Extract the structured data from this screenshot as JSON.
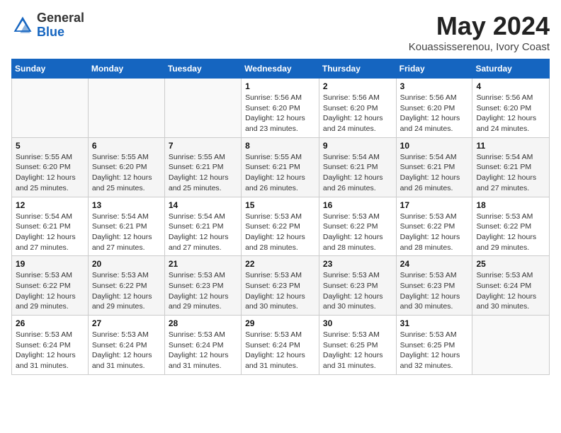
{
  "logo": {
    "general": "General",
    "blue": "Blue"
  },
  "title": "May 2024",
  "subtitle": "Kouassisserenou, Ivory Coast",
  "days_header": [
    "Sunday",
    "Monday",
    "Tuesday",
    "Wednesday",
    "Thursday",
    "Friday",
    "Saturday"
  ],
  "weeks": [
    [
      {
        "day": "",
        "info": ""
      },
      {
        "day": "",
        "info": ""
      },
      {
        "day": "",
        "info": ""
      },
      {
        "day": "1",
        "info": "Sunrise: 5:56 AM\nSunset: 6:20 PM\nDaylight: 12 hours\nand 23 minutes."
      },
      {
        "day": "2",
        "info": "Sunrise: 5:56 AM\nSunset: 6:20 PM\nDaylight: 12 hours\nand 24 minutes."
      },
      {
        "day": "3",
        "info": "Sunrise: 5:56 AM\nSunset: 6:20 PM\nDaylight: 12 hours\nand 24 minutes."
      },
      {
        "day": "4",
        "info": "Sunrise: 5:56 AM\nSunset: 6:20 PM\nDaylight: 12 hours\nand 24 minutes."
      }
    ],
    [
      {
        "day": "5",
        "info": "Sunrise: 5:55 AM\nSunset: 6:20 PM\nDaylight: 12 hours\nand 25 minutes."
      },
      {
        "day": "6",
        "info": "Sunrise: 5:55 AM\nSunset: 6:20 PM\nDaylight: 12 hours\nand 25 minutes."
      },
      {
        "day": "7",
        "info": "Sunrise: 5:55 AM\nSunset: 6:21 PM\nDaylight: 12 hours\nand 25 minutes."
      },
      {
        "day": "8",
        "info": "Sunrise: 5:55 AM\nSunset: 6:21 PM\nDaylight: 12 hours\nand 26 minutes."
      },
      {
        "day": "9",
        "info": "Sunrise: 5:54 AM\nSunset: 6:21 PM\nDaylight: 12 hours\nand 26 minutes."
      },
      {
        "day": "10",
        "info": "Sunrise: 5:54 AM\nSunset: 6:21 PM\nDaylight: 12 hours\nand 26 minutes."
      },
      {
        "day": "11",
        "info": "Sunrise: 5:54 AM\nSunset: 6:21 PM\nDaylight: 12 hours\nand 27 minutes."
      }
    ],
    [
      {
        "day": "12",
        "info": "Sunrise: 5:54 AM\nSunset: 6:21 PM\nDaylight: 12 hours\nand 27 minutes."
      },
      {
        "day": "13",
        "info": "Sunrise: 5:54 AM\nSunset: 6:21 PM\nDaylight: 12 hours\nand 27 minutes."
      },
      {
        "day": "14",
        "info": "Sunrise: 5:54 AM\nSunset: 6:21 PM\nDaylight: 12 hours\nand 27 minutes."
      },
      {
        "day": "15",
        "info": "Sunrise: 5:53 AM\nSunset: 6:22 PM\nDaylight: 12 hours\nand 28 minutes."
      },
      {
        "day": "16",
        "info": "Sunrise: 5:53 AM\nSunset: 6:22 PM\nDaylight: 12 hours\nand 28 minutes."
      },
      {
        "day": "17",
        "info": "Sunrise: 5:53 AM\nSunset: 6:22 PM\nDaylight: 12 hours\nand 28 minutes."
      },
      {
        "day": "18",
        "info": "Sunrise: 5:53 AM\nSunset: 6:22 PM\nDaylight: 12 hours\nand 29 minutes."
      }
    ],
    [
      {
        "day": "19",
        "info": "Sunrise: 5:53 AM\nSunset: 6:22 PM\nDaylight: 12 hours\nand 29 minutes."
      },
      {
        "day": "20",
        "info": "Sunrise: 5:53 AM\nSunset: 6:22 PM\nDaylight: 12 hours\nand 29 minutes."
      },
      {
        "day": "21",
        "info": "Sunrise: 5:53 AM\nSunset: 6:23 PM\nDaylight: 12 hours\nand 29 minutes."
      },
      {
        "day": "22",
        "info": "Sunrise: 5:53 AM\nSunset: 6:23 PM\nDaylight: 12 hours\nand 30 minutes."
      },
      {
        "day": "23",
        "info": "Sunrise: 5:53 AM\nSunset: 6:23 PM\nDaylight: 12 hours\nand 30 minutes."
      },
      {
        "day": "24",
        "info": "Sunrise: 5:53 AM\nSunset: 6:23 PM\nDaylight: 12 hours\nand 30 minutes."
      },
      {
        "day": "25",
        "info": "Sunrise: 5:53 AM\nSunset: 6:24 PM\nDaylight: 12 hours\nand 30 minutes."
      }
    ],
    [
      {
        "day": "26",
        "info": "Sunrise: 5:53 AM\nSunset: 6:24 PM\nDaylight: 12 hours\nand 31 minutes."
      },
      {
        "day": "27",
        "info": "Sunrise: 5:53 AM\nSunset: 6:24 PM\nDaylight: 12 hours\nand 31 minutes."
      },
      {
        "day": "28",
        "info": "Sunrise: 5:53 AM\nSunset: 6:24 PM\nDaylight: 12 hours\nand 31 minutes."
      },
      {
        "day": "29",
        "info": "Sunrise: 5:53 AM\nSunset: 6:24 PM\nDaylight: 12 hours\nand 31 minutes."
      },
      {
        "day": "30",
        "info": "Sunrise: 5:53 AM\nSunset: 6:25 PM\nDaylight: 12 hours\nand 31 minutes."
      },
      {
        "day": "31",
        "info": "Sunrise: 5:53 AM\nSunset: 6:25 PM\nDaylight: 12 hours\nand 32 minutes."
      },
      {
        "day": "",
        "info": ""
      }
    ]
  ]
}
